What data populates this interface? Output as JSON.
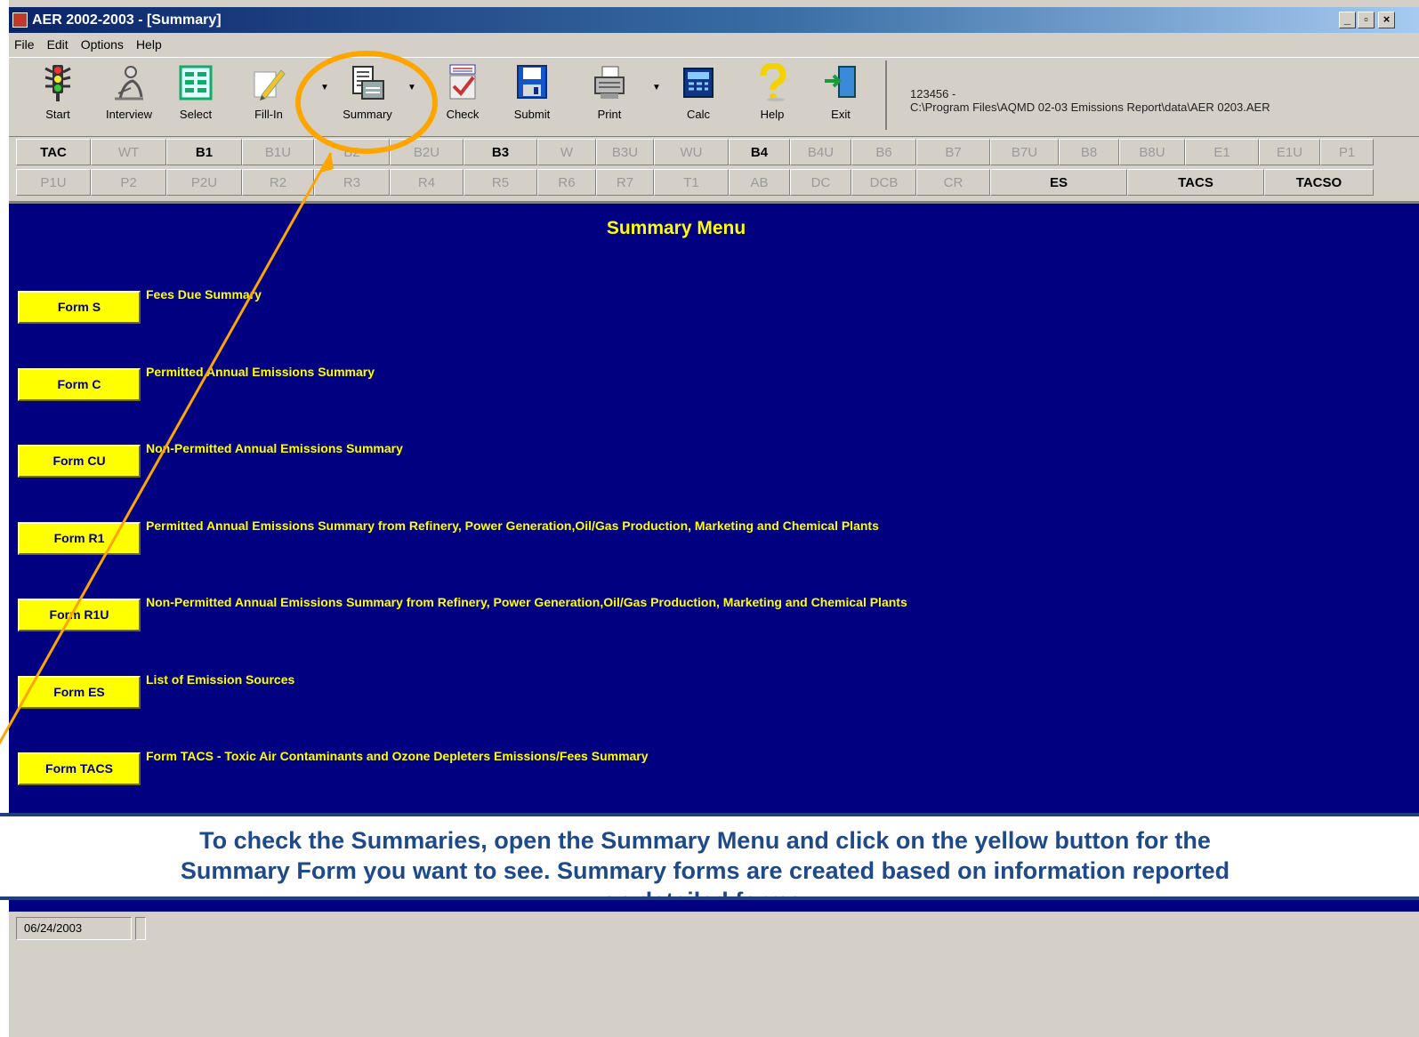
{
  "window": {
    "title": "AER 2002-2003 - [Summary]",
    "controls": [
      "_",
      "▫",
      "×"
    ]
  },
  "menu": [
    "File",
    "Edit",
    "Options",
    "Help"
  ],
  "toolbar": {
    "buttons": [
      {
        "label": "Start",
        "icon": "traffic-light-icon"
      },
      {
        "label": "Interview",
        "icon": "person-writing-icon"
      },
      {
        "label": "Select",
        "icon": "list-select-icon"
      },
      {
        "label": "Fill-In",
        "icon": "pencil-icon"
      },
      {
        "label": "Summary",
        "icon": "summary-report-icon"
      },
      {
        "label": "Check",
        "icon": "check-clipboard-icon"
      },
      {
        "label": "Submit",
        "icon": "floppy-disk-icon"
      },
      {
        "label": "Print",
        "icon": "printer-icon"
      },
      {
        "label": "Calc",
        "icon": "calculator-icon"
      },
      {
        "label": "Help",
        "icon": "question-mark-icon"
      },
      {
        "label": "Exit",
        "icon": "exit-door-icon"
      }
    ],
    "file_id": "123456 -",
    "file_path": "C:\\Program Files\\AQMD 02-03 Emissions Report\\data\\AER 0203.AER"
  },
  "tabs_row1": [
    "TAC",
    "WT",
    "B1",
    "B1U",
    "B2",
    "B2U",
    "B3",
    "W",
    "B3U",
    "WU",
    "B4",
    "B4U",
    "B6",
    "B7",
    "B7U",
    "B8",
    "B8U",
    "E1",
    "E1U",
    "P1"
  ],
  "tabs_row2": [
    "P1U",
    "P2",
    "P2U",
    "R2",
    "R3",
    "R4",
    "R5",
    "R6",
    "R7",
    "T1",
    "AB",
    "DC",
    "DCB",
    "CR",
    "ES",
    "TACS",
    "TACSO"
  ],
  "summary": {
    "title": "Summary Menu",
    "forms": [
      {
        "button": "Form S",
        "desc": "Fees Due Summary"
      },
      {
        "button": "Form C",
        "desc": "Permitted Annual Emissions Summary"
      },
      {
        "button": "Form CU",
        "desc": "Non-Permitted Annual Emissions Summary"
      },
      {
        "button": "Form R1",
        "desc": "Permitted Annual Emissions Summary from Refinery, Power Generation,Oil/Gas Production, Marketing and Chemical Plants"
      },
      {
        "button": "Form R1U",
        "desc": "Non-Permitted Annual Emissions Summary from Refinery, Power Generation,Oil/Gas Production, Marketing and Chemical Plants"
      },
      {
        "button": "Form ES",
        "desc": "List of Emission Sources"
      },
      {
        "button": "Form TACS",
        "desc": "Form TACS - Toxic Air Contaminants and Ozone Depleters Emissions/Fees Summary"
      }
    ]
  },
  "instruction": {
    "line1": "To check the Summaries, open the Summary Menu and click on the yellow button for the",
    "line2": "Summary Form you want to see. Summary forms are created based on information reported",
    "line3": "on detailed forms."
  },
  "status": {
    "date": "06/24/2003"
  },
  "colors": {
    "panel": "#000080",
    "accent_yellow": "#ffff00",
    "annotation_orange": "#ffa500",
    "instruction_text": "#1f4a8a"
  }
}
